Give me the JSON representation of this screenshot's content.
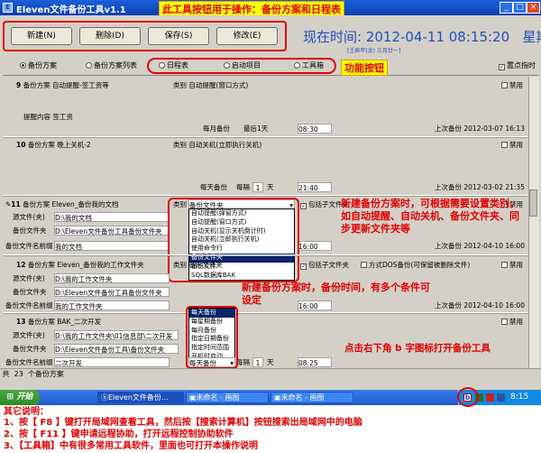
{
  "window": {
    "title": "Eleven文件备份工具v1.1"
  },
  "callouts": {
    "top": "此工具按钮用于操作：备份方案和日程表",
    "func": "功能按钮",
    "scheme": "新建备份方案时，可根据需要设置类别，如自动提醒、自动关机、备份文件夹、同步更新文件夹等",
    "time": "新建备份方案时，备份时间，有多个条件可设定",
    "tray": "点击右下角 b 字图标打开备份工具"
  },
  "toolbar": {
    "new": "新建(N)",
    "delete": "删除(D)",
    "save": "保存(S)",
    "modify": "修改(E)"
  },
  "clock": {
    "time": "现在时间: 2012-04-11 08:15:20",
    "weekday": "星期三",
    "lunar": "[壬辰年(龙) 三月廿一]"
  },
  "tabs": [
    "备份方案",
    "备份方案列表",
    "日程表",
    "启动项目",
    "工具箱"
  ],
  "top_pin": "置点指时",
  "schemes": [
    {
      "num": "9",
      "title_label": "备份方案",
      "title": "自动提醒-签工资等",
      "cat_label": "类别",
      "cat": "自动提醒(窗口方式)",
      "disable": "禁用",
      "content_label": "提醒内容",
      "content": "签工资",
      "freq": "每月备份",
      "freq2": "最后1天",
      "time": "08:30",
      "last_label": "上次备份",
      "last": "2012-03-07 16:13"
    },
    {
      "num": "10",
      "title_label": "备份方案",
      "title": "晚上关机-2",
      "cat_label": "类别",
      "cat": "自动关机(立即执行关机)",
      "disable": "禁用",
      "freq": "每天备份",
      "every_label": "每隔",
      "every": "1",
      "unit": "天",
      "time": "21:40",
      "last_label": "上次备份",
      "last": "2012-03-02 21:35"
    },
    {
      "num": "11",
      "title_label": "备份方案",
      "title": "Eleven_备份我的文档",
      "cat_label": "类别",
      "cat": "备份文件夹",
      "include": "包括子文件夹",
      "disable": "禁用",
      "src_label": "源文件(夹)",
      "src": "D:\\我的文档",
      "dst_label": "备份文件夹",
      "dst": "D:\\Eleven文件备份工具备份文件夹",
      "prefix_label": "备份文件名前缀",
      "prefix": "我的文档",
      "freq": "每天备份",
      "every_label": "每隔",
      "every": "1",
      "unit": "天",
      "time": "16:00",
      "last_label": "上次备份",
      "last": "2012-04-10 16:00"
    },
    {
      "num": "12",
      "title_label": "备份方案",
      "title": "Eleven_备份我的工作文件夹",
      "cat_label": "类别",
      "cat": "备份文件夹",
      "include": "包括子文件夹",
      "dos": "方式DOS备份(可保留被删除文件)",
      "disable": "禁用",
      "src_label": "源文件(夹)",
      "src": "D:\\我的工作文件夹",
      "dst_label": "备份文件夹",
      "dst": "D:\\Eleven文件备份工具备份文件夹",
      "prefix_label": "备份文件名前缀",
      "prefix": "我的工作文件夹",
      "time": "16:00",
      "last_label": "上次备份",
      "last": "2012-04-10 16:00"
    },
    {
      "num": "13",
      "title_label": "备份方案",
      "title": "BAK_二次开发",
      "disable": "禁用",
      "src_label": "源文件(夹)",
      "src": "D:\\我的工作文件夹\\01信息部\\二次开发",
      "dst_label": "备份文件夹",
      "dst": "D:\\Eleven文件备份工具\\备份文件夹",
      "prefix_label": "备份文件名前缀",
      "prefix": "二次开发",
      "freq": "每天备份",
      "every_label": "每隔",
      "every": "1",
      "unit": "天",
      "time": "08:25"
    }
  ],
  "category_dropdown": [
    "自动提醒(弹窗方式)",
    "自动提醒(窗口方式)",
    "自动关机(显示关机倒计时)",
    "自动关机(立即执行关机)",
    "使用命令行",
    "备份文件夹",
    "备份文件",
    "SQL数据库BAK"
  ],
  "time_dropdown": [
    "每天备份",
    "每星期备份",
    "每月备份",
    "指定日期备份",
    "指定时间范围",
    "开机时启动"
  ],
  "status": {
    "prefix": "共",
    "count": "23",
    "suffix": "个备份方案"
  },
  "taskbar": {
    "start": "开始",
    "tasks": [
      "Eleven文件备份...",
      "未命名 - 画图",
      "未命名 - 画图"
    ],
    "clock": "8:15"
  },
  "notes": {
    "title": "其它说明：",
    "items": [
      "1、按【  F8  】键打开局域网查看工具，然后按【搜索计算机】按钮搜索出局域网中的电脑",
      "2、按【  F11  】键申请远程协助，打开远程控制协助软件",
      "3、【工具箱】中有很多常用工具软件，里面也可打开本操作说明"
    ]
  },
  "colors": {
    "accent_red": "#e00000",
    "callout_bg": "#ffff00",
    "clock_blue": "#1f4fbd",
    "title_blue": "#0a3fb0"
  }
}
